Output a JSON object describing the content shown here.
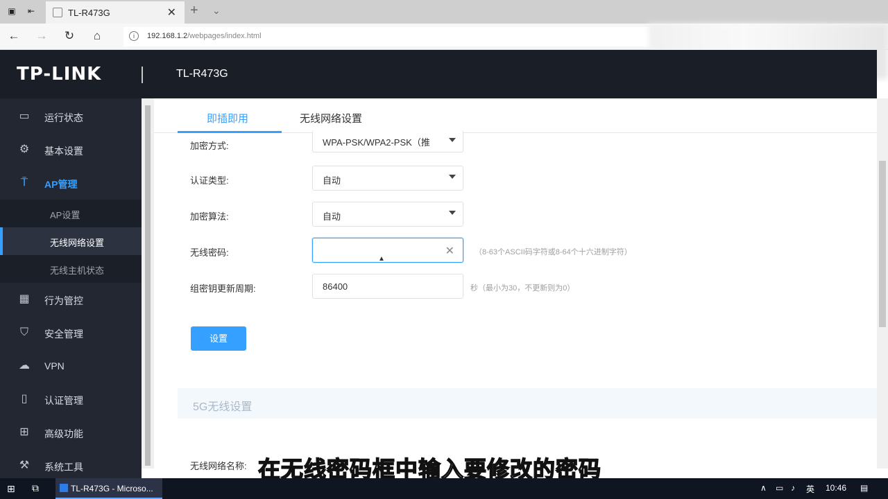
{
  "browser": {
    "tab_title": "TL-R473G",
    "url_host": "192.168.1.2",
    "url_path": "/webpages/index.html"
  },
  "header": {
    "logo": "TP-LINK",
    "model": "TL-R473G"
  },
  "sidebar": {
    "items": [
      {
        "label": "运行状态",
        "icon": "monitor-icon"
      },
      {
        "label": "基本设置",
        "icon": "gear-icon"
      },
      {
        "label": "AP管理",
        "icon": "antenna-icon"
      },
      {
        "label": "行为管控",
        "icon": "control-icon"
      },
      {
        "label": "安全管理",
        "icon": "shield-icon"
      },
      {
        "label": "VPN",
        "icon": "cloud-icon"
      },
      {
        "label": "认证管理",
        "icon": "id-card-icon"
      },
      {
        "label": "高级功能",
        "icon": "grid-icon"
      },
      {
        "label": "系统工具",
        "icon": "tools-icon"
      }
    ],
    "sub_items": [
      {
        "label": "AP设置"
      },
      {
        "label": "无线网络设置"
      },
      {
        "label": "无线主机状态"
      }
    ]
  },
  "tabs": [
    {
      "label": "即插即用"
    },
    {
      "label": "无线网络设置"
    }
  ],
  "form": {
    "encryption_mode": {
      "label": "加密方式:",
      "value": "WPA-PSK/WPA2-PSK（推"
    },
    "auth_type": {
      "label": "认证类型:",
      "value": "自动"
    },
    "cipher": {
      "label": "加密算法:",
      "value": "自动"
    },
    "password": {
      "label": "无线密码:",
      "value": "",
      "hint": "（8-63个ASCII码字符或8-64个十六进制字符）"
    },
    "group_key": {
      "label": "组密钥更新周期:",
      "value": "86400",
      "hint": "秒（最小为30，不更新则为0）"
    },
    "set_button": "设置"
  },
  "section_5g": {
    "title": "5G无线设置",
    "ssid_label": "无线网络名称:"
  },
  "subtitle": "在无线密码框中输入要修改的密码",
  "taskbar": {
    "app_label": "TL-R473G - Microso...",
    "ime": "英",
    "time": "10:46"
  },
  "colors": {
    "accent": "#35a0ff",
    "header_bg": "#1a1e27",
    "sidebar_bg": "#232732"
  }
}
